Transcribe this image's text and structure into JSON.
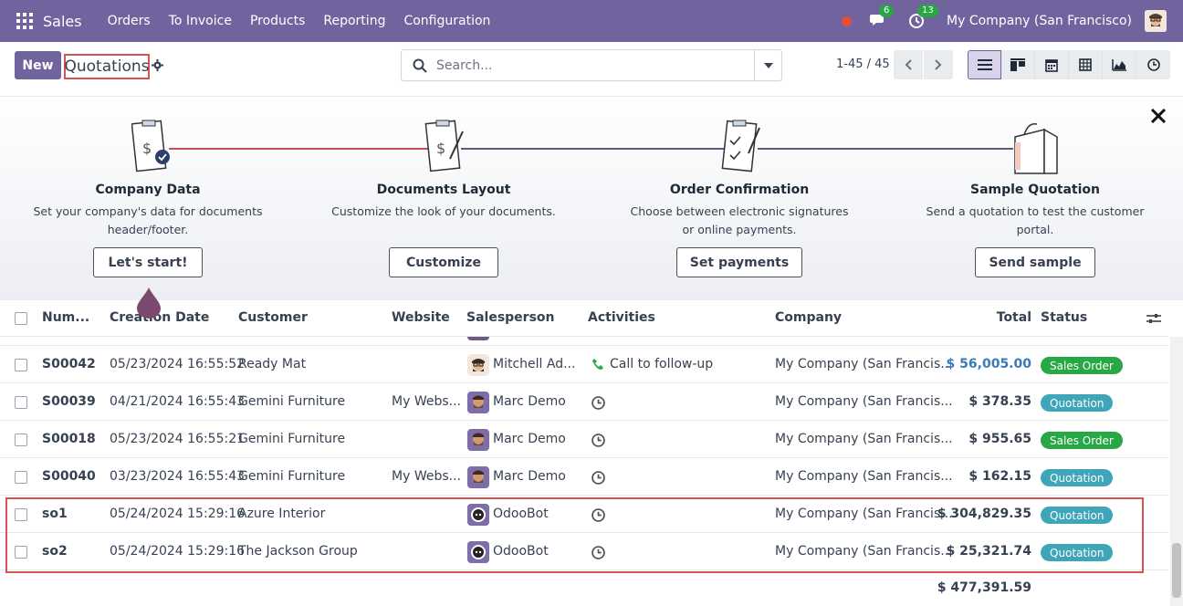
{
  "navbar": {
    "brand": "Sales",
    "menu": [
      "Orders",
      "To Invoice",
      "Products",
      "Reporting",
      "Configuration"
    ],
    "messages_count": "6",
    "activities_count": "13",
    "company": "My Company (San Francisco)"
  },
  "control": {
    "new_label": "New",
    "title": "Quotations",
    "search_placeholder": "Search...",
    "pager": "1-45 / 45"
  },
  "onboarding": {
    "steps": [
      {
        "title": "Company Data",
        "desc1": "Set your company's data for documents",
        "desc2": "header/footer.",
        "button": "Let's start!"
      },
      {
        "title": "Documents Layout",
        "desc1": "Customize the look of your documents.",
        "desc2": "",
        "button": "Customize"
      },
      {
        "title": "Order Confirmation",
        "desc1": "Choose between electronic signatures",
        "desc2": "or online payments.",
        "button": "Set payments"
      },
      {
        "title": "Sample Quotation",
        "desc1": "Send a quotation to test the customer",
        "desc2": "portal.",
        "button": "Send sample"
      }
    ]
  },
  "table": {
    "headers": {
      "number": "Num...",
      "date": "Creation Date",
      "customer": "Customer",
      "website": "Website",
      "salesperson": "Salesperson",
      "activities": "Activities",
      "company": "Company",
      "total": "Total",
      "status": "Status"
    },
    "rows": [
      {
        "number": "S00042",
        "date": "05/23/2024 16:55:52",
        "customer": "Ready Mat",
        "website": "",
        "salesperson": "Mitchell Ad...",
        "activity": "Call to follow-up",
        "company": "My Company (San Francis...",
        "total": "$ 56,005.00",
        "status": "Sales Order"
      },
      {
        "number": "S00039",
        "date": "04/21/2024 16:55:43",
        "customer": "Gemini Furniture",
        "website": "My Webs...",
        "salesperson": "Marc Demo",
        "activity": "",
        "company": "My Company (San Francis...",
        "total": "$ 378.35",
        "status": "Quotation"
      },
      {
        "number": "S00018",
        "date": "05/23/2024 16:55:21",
        "customer": "Gemini Furniture",
        "website": "",
        "salesperson": "Marc Demo",
        "activity": "",
        "company": "My Company (San Francis...",
        "total": "$ 955.65",
        "status": "Sales Order"
      },
      {
        "number": "S00040",
        "date": "03/23/2024 16:55:43",
        "customer": "Gemini Furniture",
        "website": "My Webs...",
        "salesperson": "Marc Demo",
        "activity": "",
        "company": "My Company (San Francis...",
        "total": "$ 162.15",
        "status": "Quotation"
      },
      {
        "number": "so1",
        "date": "05/24/2024 15:29:16",
        "customer": "Azure Interior",
        "website": "",
        "salesperson": "OdooBot",
        "activity": "",
        "company": "My Company (San Francis...",
        "total": "$ 304,829.35",
        "status": "Quotation"
      },
      {
        "number": "so2",
        "date": "05/24/2024 15:29:16",
        "customer": "The Jackson Group",
        "website": "",
        "salesperson": "OdooBot",
        "activity": "",
        "company": "My Company (San Francis...",
        "total": "$ 25,321.74",
        "status": "Quotation"
      }
    ],
    "grand_total": "$ 477,391.59"
  },
  "colors": {
    "brand": "#71639e",
    "sales_order": "#28a745",
    "quotation": "#3fa6b9",
    "highlight": "#d9534f"
  }
}
